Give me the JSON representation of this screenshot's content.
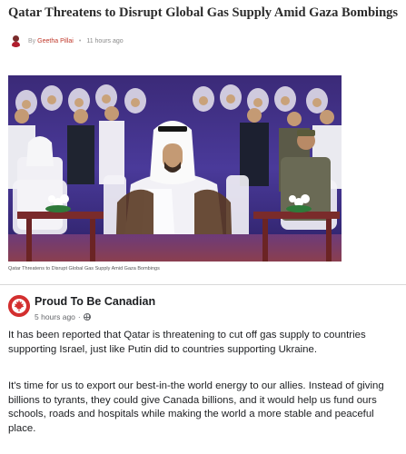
{
  "article": {
    "headline": "Qatar Threatens to Disrupt Global Gas Supply Amid Gaza Bombings",
    "by_prefix": "By",
    "author": "Geetha Pillai",
    "time": "11 hours ago",
    "caption": "Qatar Threatens to Disrupt Global Gas Supply Amid Gaza Bombings"
  },
  "post": {
    "page_name": "Proud To Be Canadian",
    "time": "5 hours ago",
    "separator": "·",
    "paragraph1": "It has been reported that Qatar is threatening to cut off gas supply to countries supporting Israel, just like Putin did to countries supporting Ukraine.",
    "paragraph2": "It's time for us to export our best-in-the world energy to our allies. Instead of giving billions to tyrants, they could give Canada billions, and it would help us fund ours schools, roads and hospitals while making the world a more stable and peaceful place."
  },
  "icons": {
    "author_avatar": "author-avatar-icon",
    "page_avatar": "maple-leaf-icon",
    "privacy": "globe-icon"
  },
  "colors": {
    "author_link": "#c0392b",
    "page_avatar_bg": "#d32f2f",
    "photo_bg": "#2a1f5e"
  }
}
